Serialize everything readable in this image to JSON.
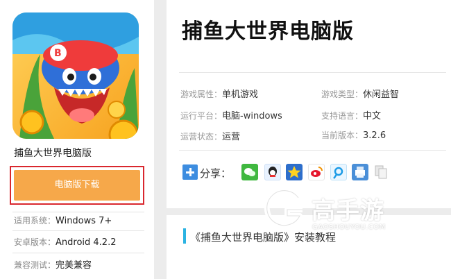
{
  "game": {
    "name": "捕鱼大世界电脑版",
    "download_label": "电脑版下载"
  },
  "specs": [
    {
      "label": "适用系统：",
      "value": "Windows 7+"
    },
    {
      "label": "安卓版本：",
      "value": "Android 4.2.2"
    },
    {
      "label": "兼容测试：",
      "value": "完美兼容"
    }
  ],
  "attributes": [
    {
      "label": "游戏属性：",
      "value": "单机游戏"
    },
    {
      "label": "游戏类型：",
      "value": "休闲益智"
    },
    {
      "label": "运行平台：",
      "value": "电脑-windows"
    },
    {
      "label": "支持语言：",
      "value": "中文"
    },
    {
      "label": "运营状态：",
      "value": "运营"
    },
    {
      "label": "当前版本：",
      "value": "3.2.6"
    }
  ],
  "share": {
    "label": "分享：",
    "icons": [
      "wechat-icon",
      "qq-icon",
      "qzone-icon",
      "weibo-icon",
      "tencent-weibo-icon",
      "print-icon",
      "copy-icon"
    ]
  },
  "tutorial": {
    "title": "《捕鱼大世界电脑版》安装教程"
  },
  "watermark": {
    "brand": "高手游",
    "url": "GAOSHOUYOU.COM"
  },
  "colors": {
    "download": "#f6a84a",
    "highlight_border": "#d9272e",
    "accent": "#2bb3e2"
  }
}
